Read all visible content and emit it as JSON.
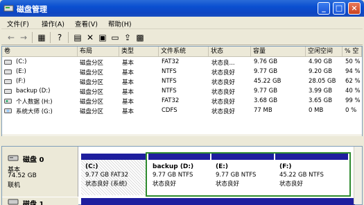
{
  "window": {
    "title": "磁盘管理"
  },
  "menu": [
    "文件(F)",
    "操作(A)",
    "查看(V)",
    "帮助(H)"
  ],
  "list": {
    "headers": [
      "卷",
      "布局",
      "类型",
      "文件系统",
      "状态",
      "容量",
      "空闲空间",
      "% 空"
    ],
    "rows": [
      [
        "(C:)",
        "磁盘分区",
        "基本",
        "FAT32",
        "状态良...",
        "9.76 GB",
        "4.90 GB",
        "50 %"
      ],
      [
        "(E:)",
        "磁盘分区",
        "基本",
        "NTFS",
        "状态良好",
        "9.77 GB",
        "9.20 GB",
        "94 %"
      ],
      [
        "(F:)",
        "磁盘分区",
        "基本",
        "NTFS",
        "状态良好",
        "45.22 GB",
        "28.05 GB",
        "62 %"
      ],
      [
        "backup (D:)",
        "磁盘分区",
        "基本",
        "NTFS",
        "状态良好",
        "9.77 GB",
        "3.99 GB",
        "40 %"
      ],
      [
        "个人数据 (H:)",
        "磁盘分区",
        "基本",
        "FAT32",
        "状态良好",
        "3.68 GB",
        "3.65 GB",
        "99 %"
      ],
      [
        "系统大师 (G:)",
        "磁盘分区",
        "基本",
        "CDFS",
        "状态良好",
        "77 MB",
        "0 MB",
        "0 %"
      ]
    ]
  },
  "disks": [
    {
      "name": "磁盘 0",
      "type": "基本",
      "size": "74.52 GB",
      "status": "联机",
      "partitions": [
        {
          "name": "(C:)",
          "info": "9.77 GB FAT32",
          "status": "状态良好 (系统)"
        },
        {
          "name": "backup  (D:)",
          "info": "9.77 GB NTFS",
          "status": "状态良好"
        },
        {
          "name": "(E:)",
          "info": "9.77 GB NTFS",
          "status": "状态良好"
        },
        {
          "name": "(F:)",
          "info": "45.22 GB NTFS",
          "status": "状态良好"
        }
      ]
    },
    {
      "name": "磁盘 1"
    }
  ],
  "colors": {
    "titlebar": "#0a4fd0",
    "primary_partition": "#1e1e9e",
    "extended_border": "#2e8b2e"
  }
}
